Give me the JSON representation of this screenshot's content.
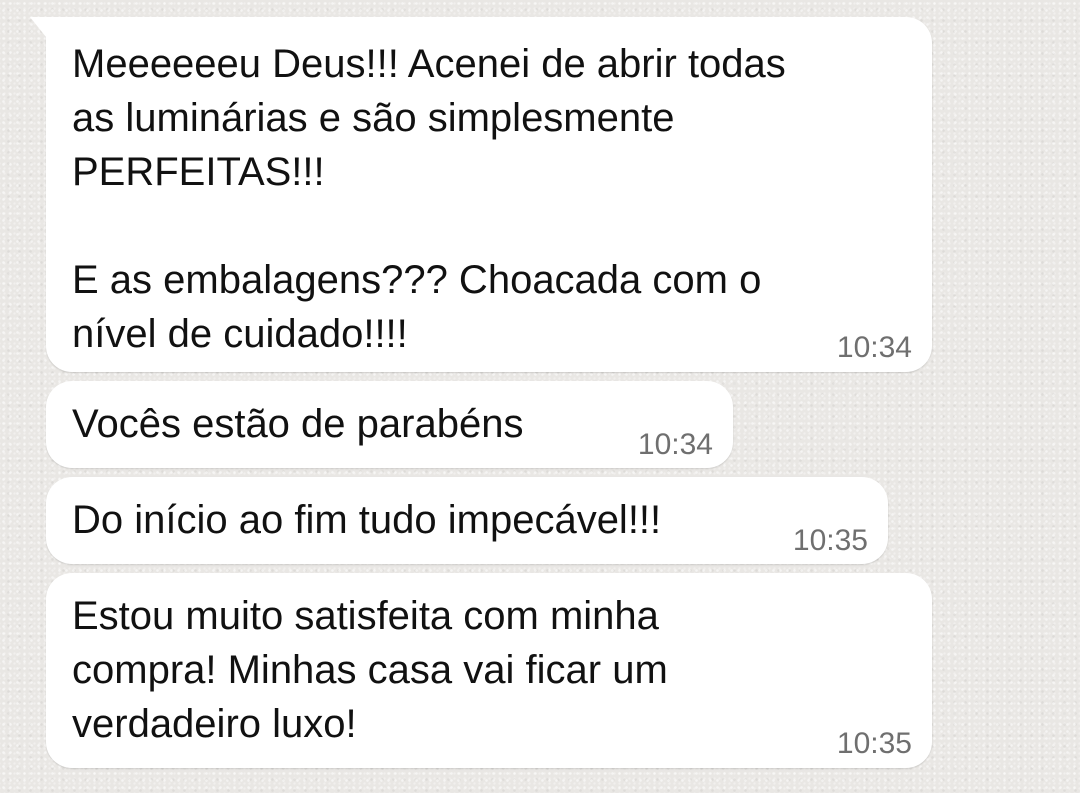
{
  "messages": [
    {
      "text": "Meeeeeeu Deus!!! Acenei de abrir todas\nas luminárias e são simplesmente\nPERFEITAS!!!\n\nE as embalagens??? Choacada com o\nnível de cuidado!!!!",
      "time": "10:34"
    },
    {
      "text": "Vocês estão de parabéns",
      "time": "10:34"
    },
    {
      "text": "Do início ao fim tudo impecável!!!",
      "time": "10:35"
    },
    {
      "text": "Estou muito satisfeita com minha\ncompra! Minhas casa vai ficar um\nverdadeiro luxo!",
      "time": "10:35"
    }
  ]
}
